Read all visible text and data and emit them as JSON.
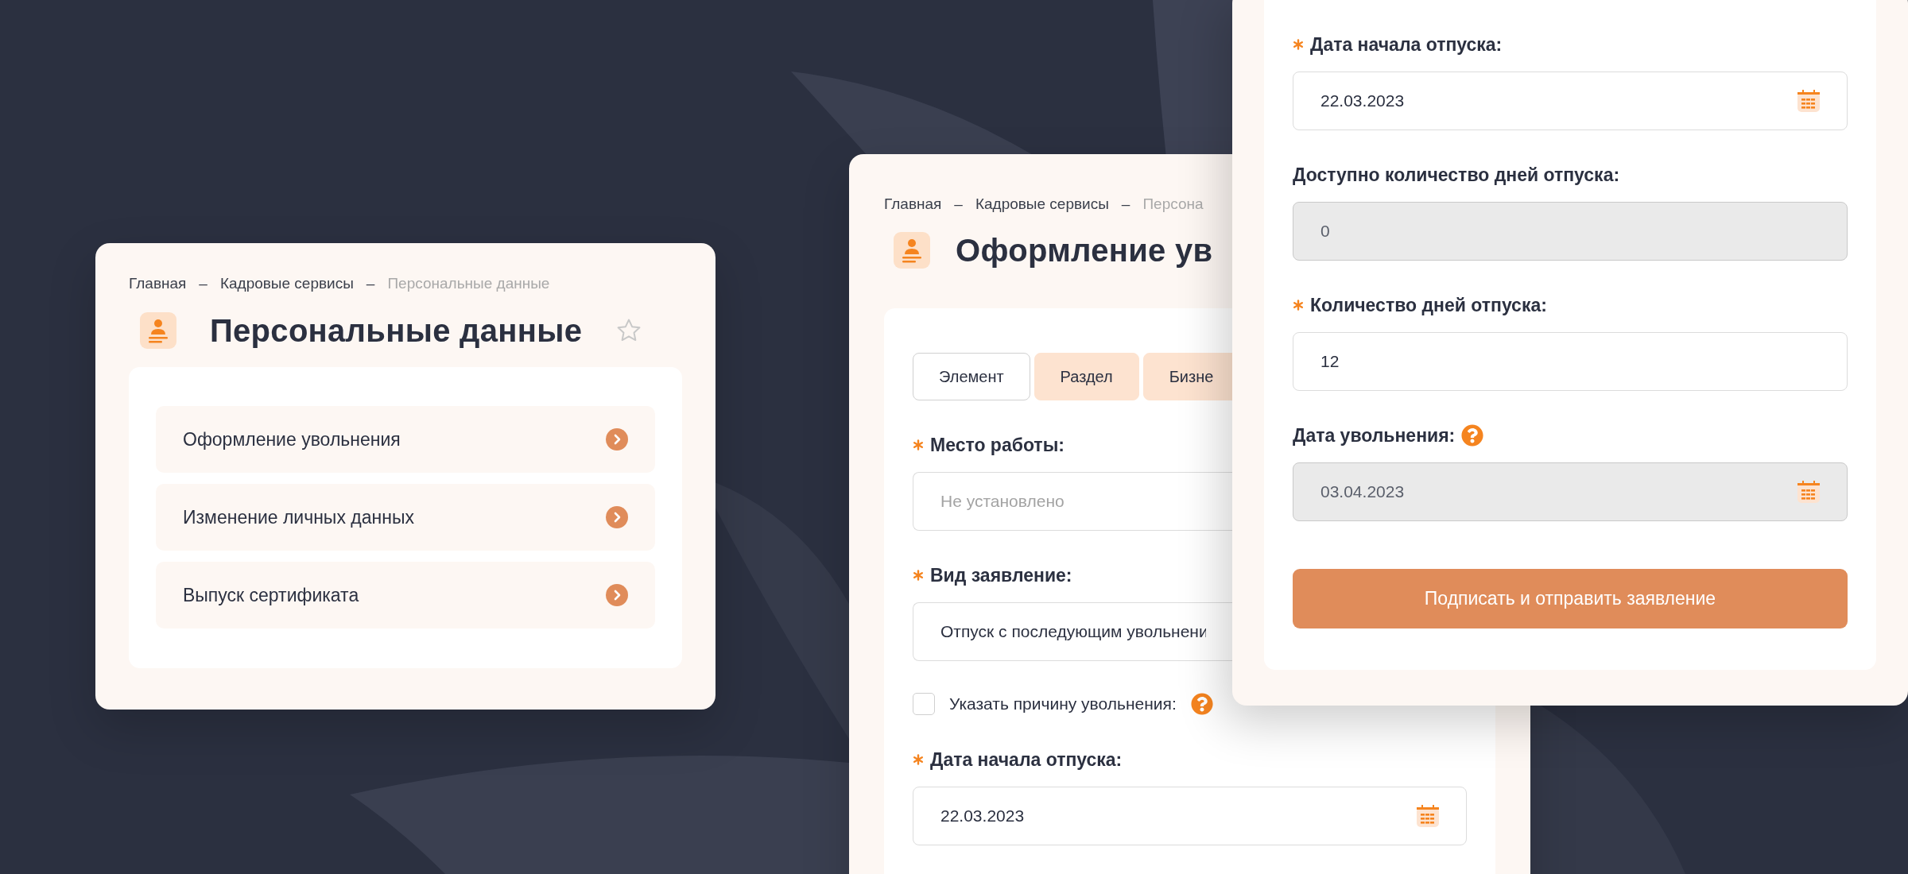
{
  "personal_data_card": {
    "breadcrumbs": [
      {
        "kind": "link",
        "label": "Главная",
        "current": false
      },
      {
        "kind": "separator",
        "label": "–"
      },
      {
        "kind": "link",
        "label": "Кадровые сервисы",
        "current": false
      },
      {
        "kind": "separator",
        "label": "–"
      },
      {
        "kind": "link",
        "label": "Персональные данные",
        "current": true
      }
    ],
    "title": "Персональные данные",
    "favorite": false,
    "items": [
      {
        "label": "Оформление увольнения"
      },
      {
        "label": "Изменение личных данных"
      },
      {
        "label": "Выпуск сертификата"
      }
    ]
  },
  "dismissal_card": {
    "breadcrumbs": [
      {
        "kind": "link",
        "label": "Главная",
        "current": false
      },
      {
        "kind": "separator",
        "label": "–"
      },
      {
        "kind": "link",
        "label": "Кадровые сервисы",
        "current": false
      },
      {
        "kind": "separator",
        "label": "–"
      },
      {
        "kind": "link",
        "label": "Персона",
        "current": true
      }
    ],
    "title": "Оформление ув",
    "tabs": [
      {
        "label": "Элемент",
        "selected": true
      },
      {
        "label": "Раздел",
        "selected": false
      },
      {
        "label": "Бизне",
        "selected": false
      }
    ],
    "fields": [
      {
        "kind": "text",
        "label": "Место работы:",
        "required": true,
        "help": false,
        "placeholder": "Не установлено",
        "disabled": false
      },
      {
        "kind": "text",
        "label": "Вид заявление:",
        "required": true,
        "help": false,
        "value": "Отпуск с последующим увольнени",
        "disabled": false
      },
      {
        "kind": "checkbox",
        "label": "Указать причину увольнения:",
        "checked": false,
        "help": true
      },
      {
        "kind": "date",
        "label": "Дата начала отпуска:",
        "required": true,
        "help": false,
        "value": "22.03.2023",
        "disabled": false
      }
    ]
  },
  "vacation_card": {
    "fields": [
      {
        "kind": "date",
        "label": "Дата начала отпуска:",
        "required": true,
        "help": false,
        "value": "22.03.2023",
        "disabled": false
      },
      {
        "kind": "text",
        "label": "Доступно количество дней отпуска:",
        "required": false,
        "help": false,
        "value": "0",
        "disabled": true
      },
      {
        "kind": "text",
        "label": "Количество дней отпуска:",
        "required": true,
        "help": false,
        "value": "12",
        "disabled": false
      },
      {
        "kind": "date",
        "label": "Дата увольнения:",
        "required": false,
        "help": true,
        "value": "03.04.2023",
        "disabled": true
      }
    ],
    "submit_button": "Подписать и отправить заявление"
  }
}
